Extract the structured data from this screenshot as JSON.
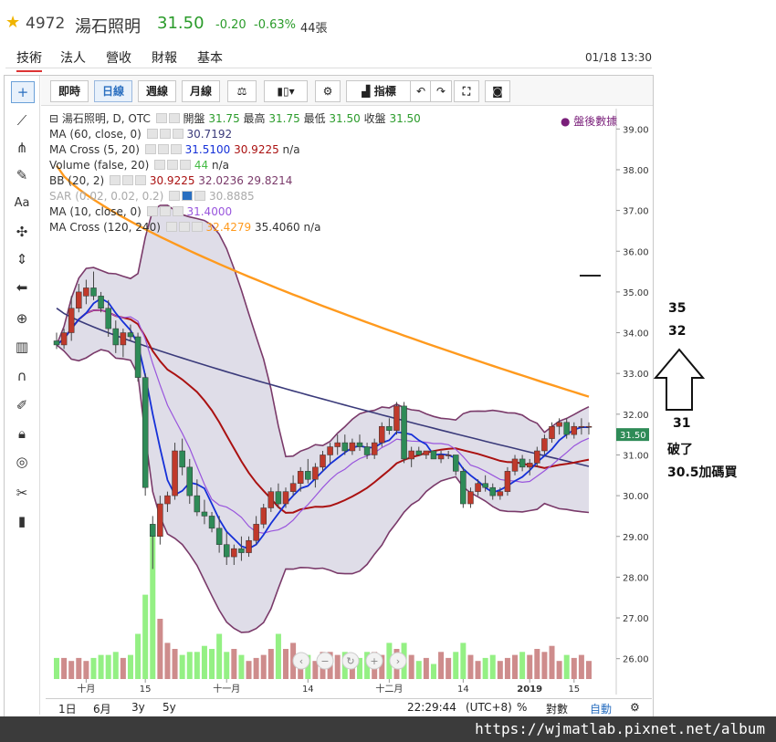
{
  "header": {
    "code": "4972",
    "name": "湯石照明",
    "price": "31.50",
    "change": "-0.20",
    "change_pct": "-0.63%",
    "volume": "44張"
  },
  "tabs": [
    "技術",
    "法人",
    "營收",
    "財報",
    "基本"
  ],
  "timestamp": "01/18 13:30",
  "toolbar": {
    "buttons": [
      "即時",
      "日線",
      "週線",
      "月線"
    ],
    "indicator_label": "指標"
  },
  "legend": {
    "main": {
      "label": "湯石照明, D, OTC",
      "open_l": "開盤",
      "open": "31.75",
      "high_l": "最高",
      "high": "31.75",
      "low_l": "最低",
      "low": "31.50",
      "close_l": "收盤",
      "close": "31.50"
    },
    "ma60": {
      "label": "MA (60, close, 0)",
      "v": "30.7192"
    },
    "macross520": {
      "label": "MA Cross (5, 20)",
      "v1": "31.5100",
      "v2": "30.9225",
      "v3": "n/a"
    },
    "volume": {
      "label": "Volume (false, 20)",
      "v1": "44",
      "v2": "n/a"
    },
    "bb": {
      "label": "BB (20, 2)",
      "v1": "30.9225",
      "v2": "32.0236",
      "v3": "29.8214"
    },
    "sar": {
      "label": "SAR (0.02, 0.02, 0.2)",
      "v": "30.8885"
    },
    "ma10": {
      "label": "MA (10, close, 0)",
      "v": "31.4000"
    },
    "macross120": {
      "label": "MA Cross (120, 240)",
      "v1": "32.4279",
      "v2": "35.4060",
      "v3": "n/a"
    },
    "after_hours": "盤後數據"
  },
  "bottom": {
    "ranges": [
      "1日",
      "6月",
      "3y",
      "5y"
    ],
    "clock": "22:29:44",
    "tz": "(UTC+8)",
    "pct": "%",
    "log": "對數",
    "auto": "自動"
  },
  "annotations": {
    "n35": "35",
    "n32": "32",
    "n31": "31",
    "broke": "破了",
    "buy": "30.5加碼買"
  },
  "watermark": "https://wjmatlab.pixnet.net/album",
  "colors": {
    "up": "#c0392b",
    "down": "#2e8b57",
    "ma5": "#1530d8",
    "ma20": "#aa1111",
    "ma10": "#9955dd",
    "ma60": "#3a3a7a",
    "ma120": "#ff9a1e",
    "bb_band": "#7a3a6a",
    "bb_fill": "#dcd9e6"
  },
  "chart_data": {
    "type": "candlestick",
    "ylim": [
      25.5,
      39.5
    ],
    "y_ticks": [
      "26.00",
      "27.00",
      "28.00",
      "29.00",
      "30.00",
      "31.00",
      "32.00",
      "33.00",
      "34.00",
      "35.00",
      "36.00",
      "37.00",
      "38.00",
      "39.00"
    ],
    "x_ticks": [
      "十月",
      "15",
      "十一月",
      "14",
      "十二月",
      "14",
      "2019",
      "15"
    ],
    "last_price_label": "31.50",
    "ohlc": [
      [
        33.8,
        34.0,
        33.6,
        33.7
      ],
      [
        33.7,
        34.1,
        33.6,
        34.0
      ],
      [
        34.0,
        34.9,
        33.8,
        34.6
      ],
      [
        34.6,
        35.2,
        34.5,
        35.0
      ],
      [
        34.9,
        35.3,
        34.7,
        35.1
      ],
      [
        35.1,
        35.5,
        34.8,
        34.9
      ],
      [
        34.9,
        35.0,
        34.5,
        34.6
      ],
      [
        34.6,
        34.8,
        33.9,
        34.1
      ],
      [
        34.1,
        34.3,
        33.5,
        33.7
      ],
      [
        33.7,
        34.1,
        33.4,
        34.0
      ],
      [
        34.0,
        34.2,
        33.8,
        33.9
      ],
      [
        33.9,
        34.0,
        32.8,
        32.9
      ],
      [
        32.9,
        33.0,
        30.0,
        30.2
      ],
      [
        29.3,
        29.5,
        28.2,
        29.0
      ],
      [
        29.0,
        30.0,
        28.8,
        29.8
      ],
      [
        29.8,
        30.1,
        29.6,
        30.0
      ],
      [
        30.0,
        31.3,
        29.9,
        31.1
      ],
      [
        31.1,
        31.4,
        30.5,
        30.7
      ],
      [
        30.7,
        30.9,
        29.8,
        30.0
      ],
      [
        30.0,
        30.4,
        29.5,
        29.6
      ],
      [
        29.6,
        29.9,
        29.3,
        29.5
      ],
      [
        29.5,
        29.6,
        29.1,
        29.2
      ],
      [
        29.2,
        29.5,
        28.6,
        28.8
      ],
      [
        28.8,
        29.1,
        28.3,
        28.5
      ],
      [
        28.5,
        28.8,
        28.3,
        28.7
      ],
      [
        28.7,
        29.0,
        28.4,
        28.6
      ],
      [
        28.6,
        29.0,
        28.5,
        28.9
      ],
      [
        28.9,
        29.5,
        28.8,
        29.3
      ],
      [
        29.3,
        29.8,
        29.2,
        29.7
      ],
      [
        29.7,
        30.2,
        29.6,
        30.1
      ],
      [
        30.1,
        30.3,
        29.7,
        29.8
      ],
      [
        29.8,
        30.2,
        29.7,
        30.1
      ],
      [
        30.1,
        30.5,
        30.0,
        30.3
      ],
      [
        30.3,
        30.7,
        30.1,
        30.6
      ],
      [
        30.6,
        30.9,
        30.3,
        30.4
      ],
      [
        30.4,
        30.8,
        30.2,
        30.7
      ],
      [
        30.7,
        31.1,
        30.6,
        31.0
      ],
      [
        31.0,
        31.3,
        30.8,
        31.2
      ],
      [
        31.2,
        31.5,
        31.0,
        31.3
      ],
      [
        31.3,
        31.5,
        31.0,
        31.1
      ],
      [
        31.1,
        31.4,
        31.0,
        31.3
      ],
      [
        31.3,
        31.5,
        31.1,
        31.2
      ],
      [
        31.2,
        31.3,
        30.9,
        31.0
      ],
      [
        31.0,
        31.4,
        30.9,
        31.3
      ],
      [
        31.3,
        31.8,
        31.2,
        31.7
      ],
      [
        31.7,
        31.9,
        31.5,
        31.6
      ],
      [
        31.6,
        32.3,
        31.5,
        32.2
      ],
      [
        32.2,
        32.3,
        30.8,
        30.9
      ],
      [
        30.9,
        31.2,
        30.7,
        31.1
      ],
      [
        31.1,
        31.2,
        31.0,
        31.0
      ],
      [
        31.0,
        31.1,
        30.9,
        31.1
      ],
      [
        31.1,
        31.1,
        30.9,
        30.9
      ],
      [
        30.9,
        31.1,
        30.8,
        31.0
      ],
      [
        31.0,
        31.1,
        30.9,
        31.0
      ],
      [
        31.0,
        31.0,
        30.5,
        30.6
      ],
      [
        30.6,
        30.7,
        29.7,
        29.8
      ],
      [
        29.8,
        30.2,
        29.7,
        30.1
      ],
      [
        30.1,
        30.4,
        30.0,
        30.3
      ],
      [
        30.3,
        30.5,
        30.1,
        30.2
      ],
      [
        30.2,
        30.3,
        29.9,
        30.0
      ],
      [
        30.0,
        30.2,
        29.9,
        30.1
      ],
      [
        30.1,
        30.7,
        30.0,
        30.6
      ],
      [
        30.6,
        31.0,
        30.5,
        30.9
      ],
      [
        30.9,
        31.0,
        30.6,
        30.7
      ],
      [
        30.7,
        30.9,
        30.5,
        30.8
      ],
      [
        30.8,
        31.2,
        30.7,
        31.1
      ],
      [
        31.1,
        31.5,
        31.0,
        31.4
      ],
      [
        31.4,
        31.8,
        31.3,
        31.7
      ],
      [
        31.7,
        31.9,
        31.5,
        31.8
      ],
      [
        31.8,
        31.9,
        31.4,
        31.5
      ],
      [
        31.5,
        31.8,
        31.4,
        31.7
      ],
      [
        31.7,
        31.9,
        31.5,
        31.7
      ],
      [
        31.7,
        31.8,
        31.5,
        31.7
      ]
    ],
    "volume": [
      7,
      7,
      6,
      7,
      6,
      7,
      8,
      8,
      9,
      7,
      8,
      15,
      28,
      48,
      20,
      12,
      10,
      8,
      9,
      9,
      11,
      10,
      15,
      9,
      10,
      8,
      6,
      7,
      8,
      10,
      15,
      10,
      12,
      7,
      8,
      6,
      9,
      9,
      8,
      9,
      8,
      7,
      9,
      9,
      8,
      12,
      10,
      12,
      8,
      6,
      7,
      5,
      9,
      7,
      9,
      12,
      8,
      6,
      7,
      8,
      6,
      7,
      8,
      9,
      8,
      10,
      9,
      11,
      6,
      8,
      7,
      8,
      6
    ]
  }
}
